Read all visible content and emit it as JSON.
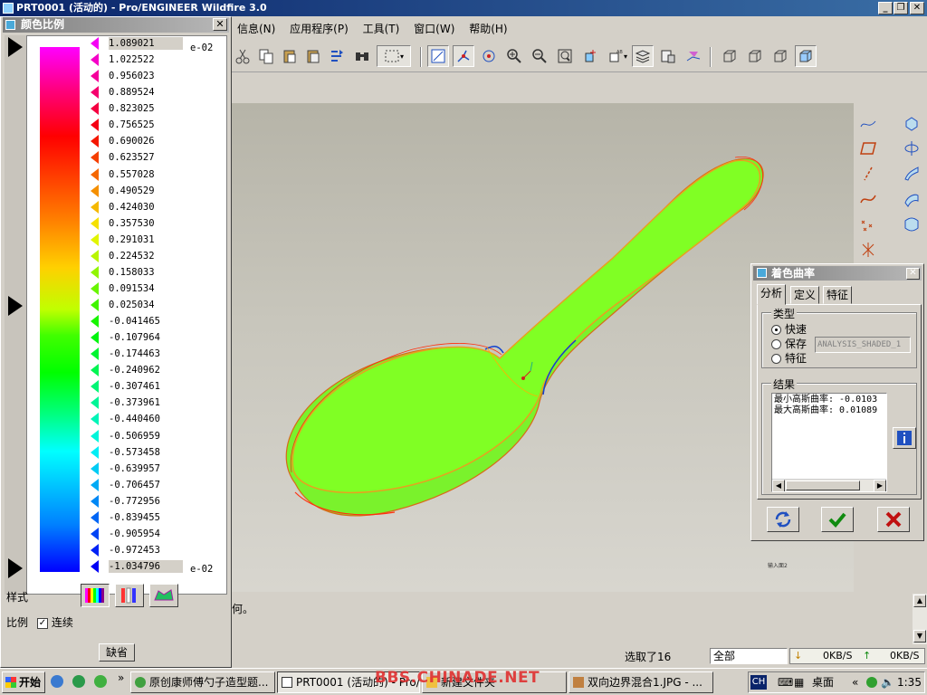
{
  "window": {
    "title": "PRT0001 (活动的) - Pro/ENGINEER Wildfire 3.0",
    "min_label": "_",
    "max_label": "❐",
    "close_label": "✕"
  },
  "menu": [
    "信息(N)",
    "应用程序(P)",
    "工具(T)",
    "窗口(W)",
    "帮助(H)"
  ],
  "color_scale": {
    "title": "颜色比例",
    "close_label": "✕",
    "values": [
      "1.089021",
      "1.022522",
      "0.956023",
      "0.889524",
      "0.823025",
      "0.756525",
      "0.690026",
      "0.623527",
      "0.557028",
      "0.490529",
      "0.424030",
      "0.357530",
      "0.291031",
      "0.224532",
      "0.158033",
      "0.091534",
      "0.025034",
      "-0.041465",
      "-0.107964",
      "-0.174463",
      "-0.240962",
      "-0.307461",
      "-0.373961",
      "-0.440460",
      "-0.506959",
      "-0.573458",
      "-0.639957",
      "-0.706457",
      "-0.772956",
      "-0.839455",
      "-0.905954",
      "-0.972453",
      "-1.034796"
    ],
    "top_exponent": "e-02",
    "bottom_exponent": "e-02",
    "style_label": "样式",
    "scale_label": "比例",
    "continuous_label": "连续",
    "continuous_checked": true,
    "default_button": "缺省"
  },
  "dialog": {
    "title": "着色曲率",
    "close_label": "✕",
    "tabs": [
      "分析",
      "定义",
      "特征"
    ],
    "active_tab": 0,
    "type_group": "类型",
    "options": [
      "快速",
      "保存",
      "特征"
    ],
    "selected_option": 0,
    "save_name": "ANALYSIS_SHADED_1",
    "results_group": "结果",
    "results": [
      "最小高斯曲率: -0.0103",
      "最大高斯曲率: 0.01089"
    ]
  },
  "message": "何。",
  "status": {
    "selection": "选取了16",
    "filter": "全部",
    "down_rate": "0KB/S",
    "up_rate": "0KB/S"
  },
  "viewport": {
    "note": "输入面2"
  },
  "taskbar": {
    "start": "开始",
    "tasks": [
      "原创康师傅勺子造型题...",
      "PRT0001 (活动的) - Pro/...",
      "新建文件夹",
      "双向边界混合1.JPG - ..."
    ],
    "active_task": 1,
    "watermark": "BBS.CHINADE.NET",
    "input_method": "CH",
    "desktop": "桌面",
    "clock": "1:35"
  },
  "colors": {
    "model_green": "#7fff2a",
    "title_blue": "#0a246a"
  }
}
